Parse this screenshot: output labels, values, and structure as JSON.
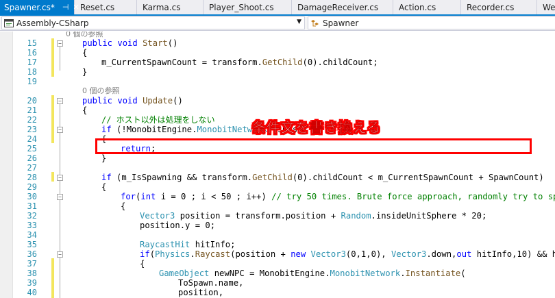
{
  "tabs": [
    {
      "label": "Spawner.cs*",
      "active": true
    },
    {
      "label": "Reset.cs"
    },
    {
      "label": "Karma.cs"
    },
    {
      "label": "Player_Shoot.cs"
    },
    {
      "label": "DamageReceiver.cs"
    },
    {
      "label": "Action.cs"
    },
    {
      "label": "Recorder.cs"
    },
    {
      "label": "Weap"
    }
  ],
  "tab_icons": {
    "pin": "⊣",
    "close": "✕"
  },
  "navbar": {
    "project": "Assembly-CSharp",
    "class_member": "Spawner",
    "project_icon": "csharp-project-icon",
    "class_icon": "class-icon"
  },
  "editor": {
    "references_label_start": "0 個の参照",
    "references_label_update": "0 個の参照",
    "lines": {
      "l15": {
        "num": "15",
        "a": "public",
        "b": "void",
        "c": "Start",
        "d": "()"
      },
      "l16": {
        "num": "16",
        "t": "{"
      },
      "l17": {
        "num": "17",
        "a": "m_CurrentSpawnCount = transform.",
        "b": "GetChild",
        "c": "(0).childCount;"
      },
      "l18": {
        "num": "18",
        "t": "}"
      },
      "l19": {
        "num": "19"
      },
      "l20": {
        "num": "20",
        "a": "public",
        "b": "void",
        "c": "Update",
        "d": "()"
      },
      "l21": {
        "num": "21",
        "t": "{"
      },
      "l22": {
        "num": "22",
        "t": "// ホスト以外は処理をしない"
      },
      "l23": {
        "num": "23",
        "a": "if",
        "b": " (!MonobitEngine.",
        "c": "MonobitNetwork",
        "d": ".isHost)"
      },
      "l24": {
        "num": "24",
        "t": "{"
      },
      "l25": {
        "num": "25",
        "a": "return",
        "b": ";"
      },
      "l26": {
        "num": "26",
        "t": "}"
      },
      "l27": {
        "num": "27"
      },
      "l28": {
        "num": "28",
        "a": "if",
        "b": " (m_IsSpawning && transform.",
        "c": "GetChild",
        "d": "(0).childCount < m_CurrentSpawnCount + SpawnCount)"
      },
      "l29": {
        "num": "29",
        "t": "{"
      },
      "l30": {
        "num": "30",
        "a": "for",
        "b": "(",
        "c": "int",
        "d": " i = 0 ; i < 50 ; i++) ",
        "e": "// try 50 times. Brute force approach, randomly try to spawn"
      },
      "l31": {
        "num": "31",
        "t": "{"
      },
      "l32": {
        "num": "32",
        "a": "Vector3",
        "b": " position = transform.position + ",
        "c": "Random",
        "d": ".insideUnitSphere * 20;"
      },
      "l33": {
        "num": "33",
        "t": "position.y = 0;"
      },
      "l34": {
        "num": "34"
      },
      "l35": {
        "num": "35",
        "a": "RaycastHit",
        "b": " hitInfo;"
      },
      "l36": {
        "num": "36",
        "a": "if",
        "b": "(",
        "c": "Physics",
        "d": ".",
        "e": "Raycast",
        "f": "(position + ",
        "g": "new",
        "h": " ",
        "i": "Vector3",
        "j": "(0,1,0), ",
        "k": "Vector3",
        "l": ".down,",
        "m": "out",
        "n": " hitInfo,10) && hitIn"
      },
      "l37": {
        "num": "37",
        "t": "{"
      },
      "l38": {
        "num": "38",
        "a": "GameObject",
        "b": " newNPC = MonobitEngine.",
        "c": "MonobitNetwork",
        "d": ".",
        "e": "Instantiate",
        "f": "("
      },
      "l39": {
        "num": "39",
        "t": "ToSpawn.name,"
      },
      "l40": {
        "num": "40",
        "t": "position,"
      }
    }
  },
  "annotation": {
    "label": "条件文を書き換える",
    "color": "#ff0000"
  },
  "colors": {
    "accent": "#007acc",
    "keyword": "#0000ff",
    "type": "#2b91af",
    "method": "#74531f",
    "comment": "#008000",
    "change_marker": "#f3e65d"
  }
}
